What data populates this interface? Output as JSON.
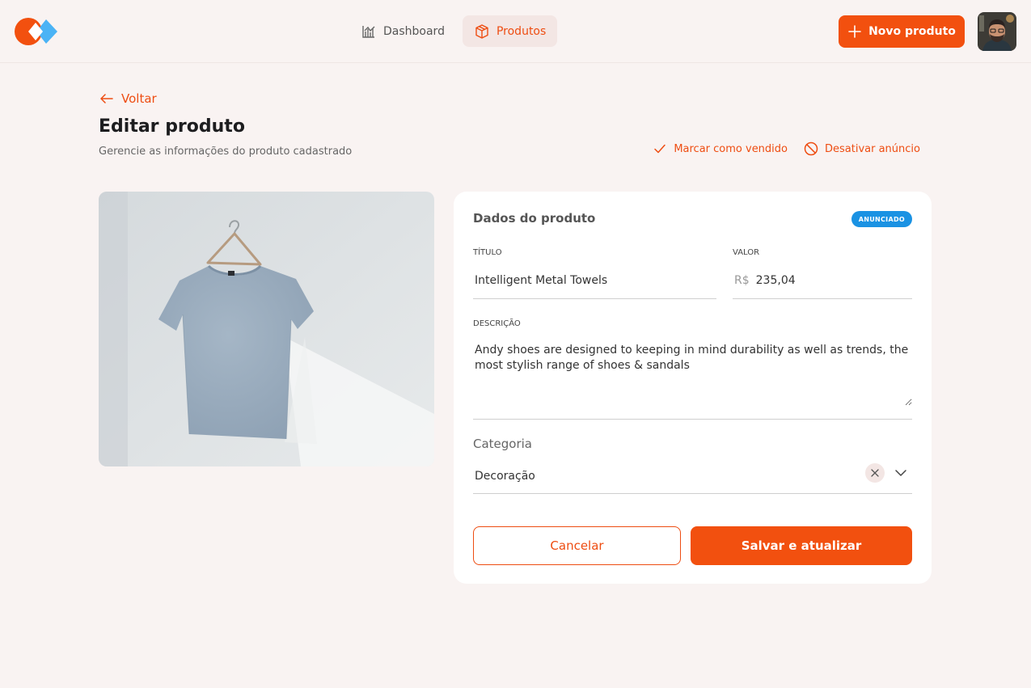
{
  "colors": {
    "accent": "#f2500f",
    "badge": "#1a92e3",
    "background": "#f9f3f2"
  },
  "logo": {
    "icon": "app-logo-icon"
  },
  "nav": {
    "items": [
      {
        "label": "Dashboard",
        "icon": "chart-icon",
        "active": false
      },
      {
        "label": "Produtos",
        "icon": "box-icon",
        "active": true
      }
    ]
  },
  "header": {
    "new_product_label": "Novo produto",
    "avatar": "user-avatar"
  },
  "page": {
    "back_label": "Voltar",
    "title": "Editar produto",
    "subtitle": "Gerencie as informações do produto cadastrado",
    "mark_sold_label": "Marcar como vendido",
    "deactivate_label": "Desativar anúncio"
  },
  "product_image": {
    "subject": "t-shirt-on-hanger"
  },
  "form": {
    "title": "Dados do produto",
    "status_badge": "ANUNCIADO",
    "title_label": "Título",
    "title_value": "Intelligent Metal Towels",
    "value_label": "Valor",
    "currency": "R$",
    "value_value": "235,04",
    "description_label": "Descrição",
    "description_value": "Andy shoes are designed to keeping in mind durability as well as trends, the most stylish range of shoes & sandals",
    "category_label": "Categoria",
    "category_value": "Decoração",
    "cancel_label": "Cancelar",
    "save_label": "Salvar e atualizar"
  }
}
